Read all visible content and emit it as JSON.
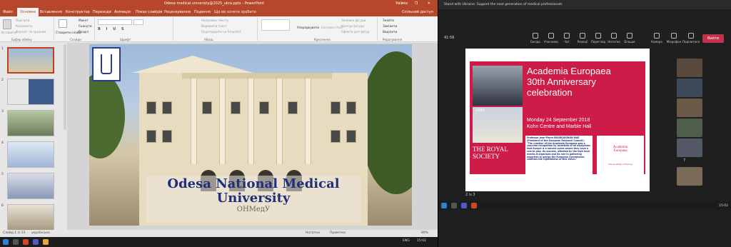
{
  "powerpoint": {
    "title": "Odesa medical university@2025_ukra.pptx - PowerPoint",
    "search": "Що ви хочете зробити",
    "user": "Увійти",
    "tabs": [
      "Файл",
      "Основне",
      "Вставлення",
      "Конструктор",
      "Переходи",
      "Анімація",
      "Показ слайдів",
      "Рецензування",
      "Подання"
    ],
    "share": "Спільний доступ",
    "ribbon": {
      "paste": "Вставити",
      "cut": "Вирізати",
      "copy": "Копіювати",
      "format_painter": "Формат за зразком",
      "new_slide": "Створити слайд",
      "layout": "Макет",
      "reset": "Скинути",
      "section": "Розділ",
      "text_direction": "Напрямок тексту",
      "align_text": "Вирівняти текст",
      "convert_smartart": "Перетворити на SmartArt",
      "arrange": "Упорядкувати",
      "quick_styles": "Експрес-стилі",
      "shape_fill": "Заливка фігури",
      "shape_outline": "Контур фігури",
      "shape_effects": "Ефекти для фігур",
      "find": "Знайти",
      "replace": "Замінити",
      "select": "Виділити",
      "groups": [
        "Буфер обміну",
        "Слайди",
        "Шрифт",
        "Абзац",
        "Креслення",
        "Редагування"
      ]
    },
    "thumbnail_numbers": [
      "1",
      "2",
      "3",
      "4",
      "5",
      "6"
    ],
    "slide_caption_line1": "Odesa National Medical",
    "slide_caption_line2": "University",
    "slide_watermark": "ОНМедУ",
    "status": {
      "slide": "Слайд 1 із 13",
      "language": "українська",
      "notes": "Нотатки",
      "comments": "Примітки",
      "zoom": "89%"
    },
    "taskbar_time": "15:02",
    "taskbar_lang": "ENG"
  },
  "teams": {
    "banner": "Stand with Ukraine. Support the next generation of medical professionals",
    "timer": "41:56",
    "controls": [
      "Камера",
      "Мікрофон",
      "Поділитися"
    ],
    "top_controls": [
      "Бесіда",
      "Учасники",
      "Чат",
      "Реакції",
      "Перегляд",
      "Нотатки",
      "Більше"
    ],
    "leave": "Вийти",
    "pager": "2 із 3",
    "people_count": "7",
    "taskbar_time": "15:02"
  },
  "shared_slide": {
    "title_line1": "Academia Europaea",
    "title_line2": "30th Anniversary",
    "title_line3": "celebration",
    "date_line1": "Monday 24 September 2018",
    "date_line2": "Kohn Centre and Marble Hall",
    "photo_label": "1660",
    "quote_head": "Professor Jean-Pierre BOURGUIGNON MAE (President of the European Research Council):",
    "quote_body": "\"The creation of the Academia Europaea was a concrete recognition by scientists of all disciplines that Europe is a natural scene where they have a role to play. Its success, attested by the high level events it organises and its role in gathering expertise to advise the European Commission, confirms the rightfulness of this vision.\"",
    "royal_society": "THE ROYAL SOCIETY",
    "ae_logo_line1": "Academia",
    "ae_logo_line2": "Europaea",
    "ae_logo_sub": "The Academy of Europe"
  },
  "colors": {
    "ppt_brand": "#b7472a",
    "ae_red": "#cd1c47",
    "leave_red": "#c4314b",
    "caption_blue": "#1f2f7a"
  }
}
